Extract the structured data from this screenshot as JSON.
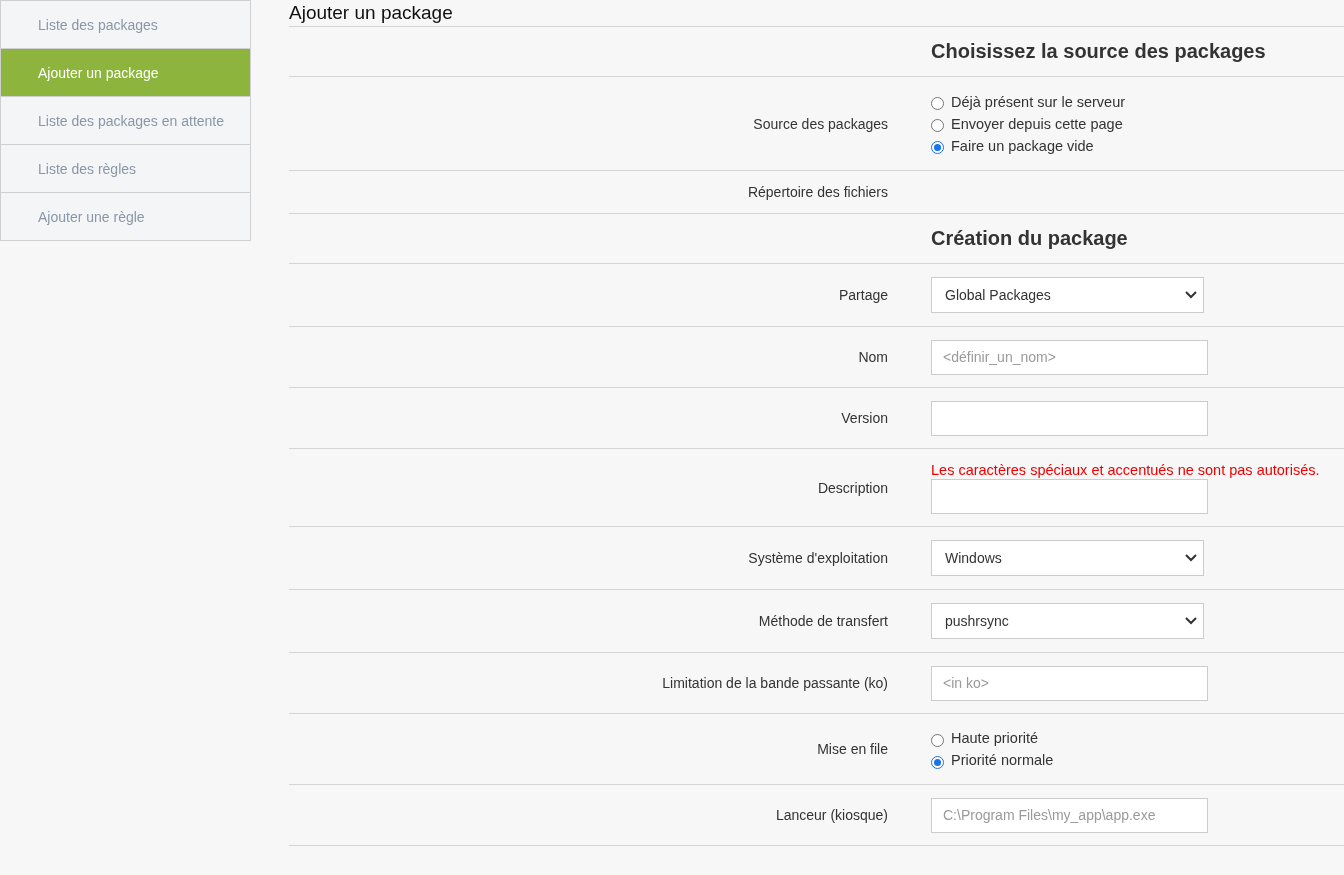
{
  "sidebar": {
    "items": [
      {
        "label": "Liste des packages",
        "selected": false
      },
      {
        "label": "Ajouter un package",
        "selected": true
      },
      {
        "label": "Liste des packages en attente",
        "selected": false
      },
      {
        "label": "Liste des règles",
        "selected": false
      },
      {
        "label": "Ajouter une règle",
        "selected": false
      }
    ]
  },
  "page_title": "Ajouter un package",
  "form_rows": [
    {
      "kind": "heading",
      "title": "Choisissez la source des packages"
    },
    {
      "kind": "radios",
      "label": "Source des packages",
      "options": [
        {
          "label": "Déjà présent sur le serveur",
          "selected": false
        },
        {
          "label": "Envoyer depuis cette page",
          "selected": false
        },
        {
          "label": "Faire un package vide",
          "selected": true
        }
      ]
    },
    {
      "kind": "text",
      "label": "Répertoire des fichiers"
    },
    {
      "kind": "heading",
      "title": "Création du package"
    },
    {
      "kind": "select",
      "label": "Partage",
      "value": "Global Packages"
    },
    {
      "kind": "input",
      "label": "Nom",
      "placeholder": "<définir_un_nom>"
    },
    {
      "kind": "input",
      "label": "Version"
    },
    {
      "kind": "input",
      "label": "Description",
      "note": "Les caractères spéciaux et accentués ne sont pas autorisés."
    },
    {
      "kind": "select",
      "label": "Système d'exploitation",
      "value": "Windows"
    },
    {
      "kind": "select",
      "label": "Méthode de transfert",
      "value": "pushrsync"
    },
    {
      "kind": "input",
      "label": "Limitation de la bande passante (ko)",
      "placeholder": "<in ko>"
    },
    {
      "kind": "radios",
      "label": "Mise en file",
      "options": [
        {
          "label": "Haute priorité",
          "selected": false
        },
        {
          "label": "Priorité normale",
          "selected": true
        }
      ]
    },
    {
      "kind": "input",
      "label": "Lanceur (kiosque)",
      "placeholder": "C:\\Program Files\\my_app\\app.exe"
    }
  ]
}
